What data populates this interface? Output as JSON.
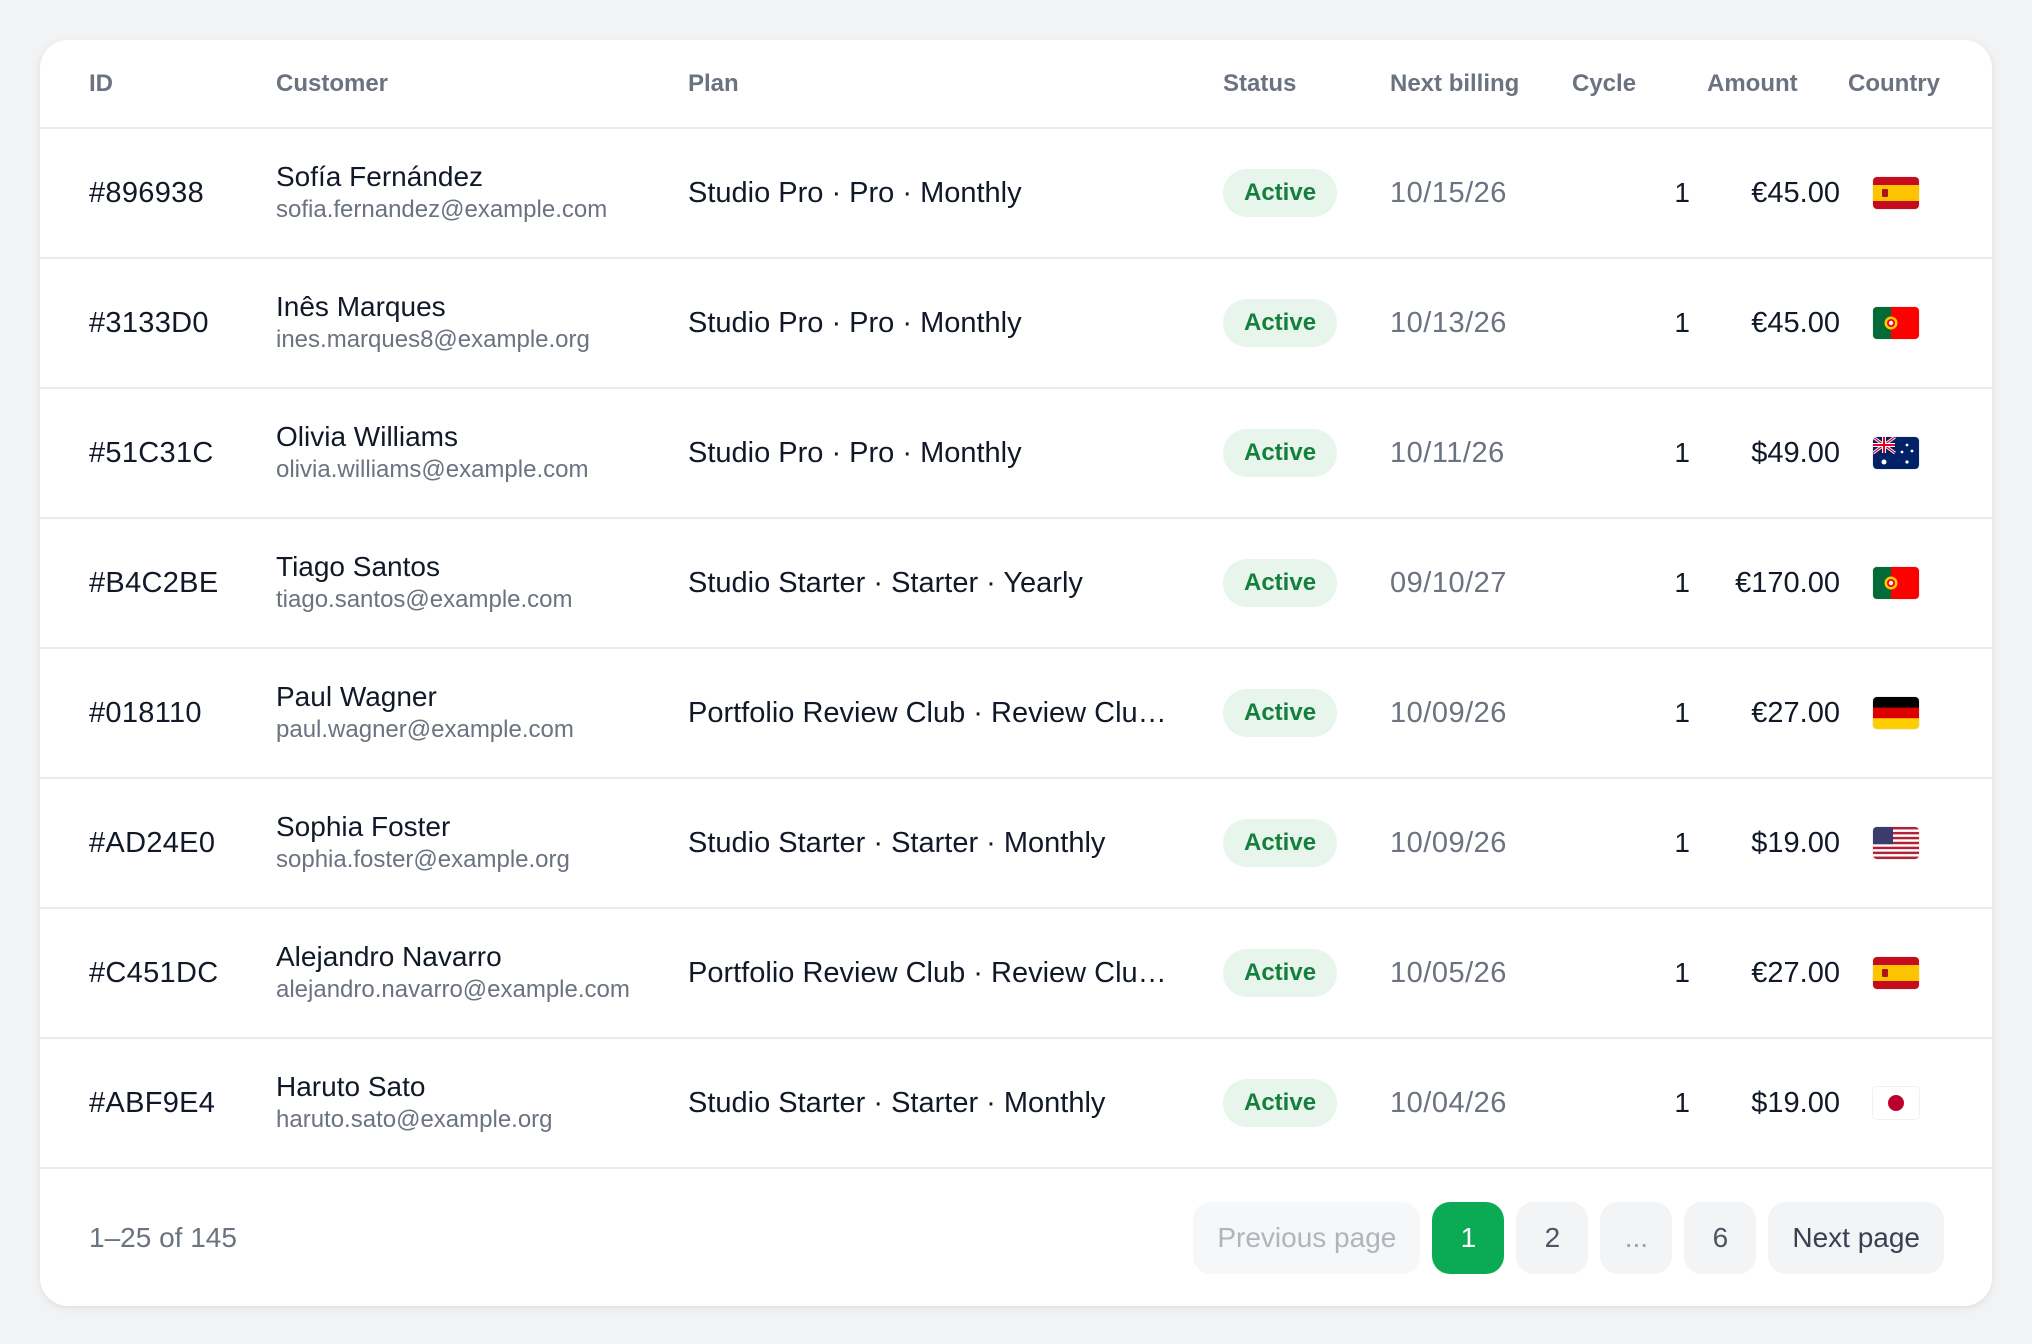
{
  "table": {
    "headers": {
      "id": "ID",
      "customer": "Customer",
      "plan": "Plan",
      "status": "Status",
      "next_billing": "Next billing",
      "cycle": "Cycle",
      "amount": "Amount",
      "country": "Country"
    },
    "rows": [
      {
        "id": "#896938",
        "name": "Sofía Fernández",
        "email": "sofia.fernandez@example.com",
        "plan": "Studio Pro · Pro · Monthly",
        "status": "Active",
        "next_billing": "10/15/26",
        "cycle": "1",
        "amount": "€45.00",
        "country_flag": "spain-flag-icon"
      },
      {
        "id": "#3133D0",
        "name": "Inês Marques",
        "email": "ines.marques8@example.org",
        "plan": "Studio Pro · Pro · Monthly",
        "status": "Active",
        "next_billing": "10/13/26",
        "cycle": "1",
        "amount": "€45.00",
        "country_flag": "portugal-flag-icon"
      },
      {
        "id": "#51C31C",
        "name": "Olivia Williams",
        "email": "olivia.williams@example.com",
        "plan": "Studio Pro · Pro · Monthly",
        "status": "Active",
        "next_billing": "10/11/26",
        "cycle": "1",
        "amount": "$49.00",
        "country_flag": "australia-flag-icon"
      },
      {
        "id": "#B4C2BE",
        "name": "Tiago Santos",
        "email": "tiago.santos@example.com",
        "plan": "Studio Starter · Starter · Yearly",
        "status": "Active",
        "next_billing": "09/10/27",
        "cycle": "1",
        "amount": "€170.00",
        "country_flag": "portugal-flag-icon"
      },
      {
        "id": "#018110",
        "name": "Paul Wagner",
        "email": "paul.wagner@example.com",
        "plan": "Portfolio Review Club · Review Club ·...",
        "status": "Active",
        "next_billing": "10/09/26",
        "cycle": "1",
        "amount": "€27.00",
        "country_flag": "germany-flag-icon"
      },
      {
        "id": "#AD24E0",
        "name": "Sophia Foster",
        "email": "sophia.foster@example.org",
        "plan": "Studio Starter · Starter · Monthly",
        "status": "Active",
        "next_billing": "10/09/26",
        "cycle": "1",
        "amount": "$19.00",
        "country_flag": "usa-flag-icon"
      },
      {
        "id": "#C451DC",
        "name": "Alejandro Navarro",
        "email": "alejandro.navarro@example.com",
        "plan": "Portfolio Review Club · Review Club ·...",
        "status": "Active",
        "next_billing": "10/05/26",
        "cycle": "1",
        "amount": "€27.00",
        "country_flag": "spain-flag-icon"
      },
      {
        "id": "#ABF9E4",
        "name": "Haruto Sato",
        "email": "haruto.sato@example.org",
        "plan": "Studio Starter · Starter · Monthly",
        "status": "Active",
        "next_billing": "10/04/26",
        "cycle": "1",
        "amount": "$19.00",
        "country_flag": "japan-flag-icon"
      }
    ]
  },
  "footer": {
    "range_text": "1–25 of 145",
    "previous_label": "Previous page",
    "pages": [
      "1",
      "2",
      "...",
      "6"
    ],
    "active_page": "1",
    "next_label": "Next page"
  },
  "colors": {
    "accent": "#0bab56",
    "badge_bg": "#e7f5ec",
    "badge_text": "#14803c",
    "muted_text": "#6b7280"
  }
}
